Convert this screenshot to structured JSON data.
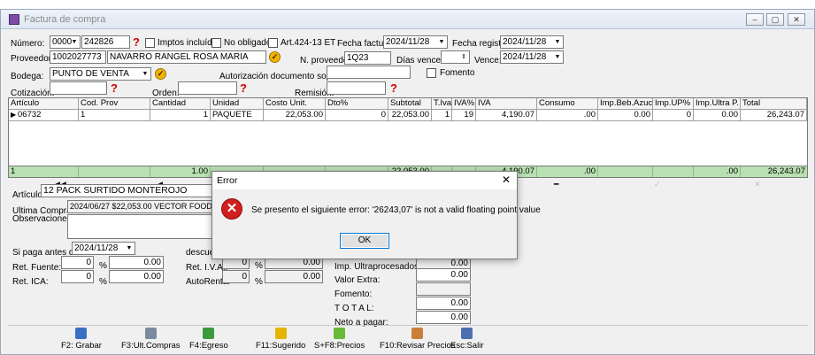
{
  "window": {
    "title": "Factura de compra"
  },
  "header": {
    "numero_label": "Número:",
    "numero_prefix": "0000",
    "numero_value": "242826",
    "imptos_incluidos": "Imptos incluídos",
    "no_obligado": "No obligado",
    "art_424": "Art.424-13 ET",
    "fecha_factura_label": "Fecha factura:",
    "fecha_factura": "2024/11/28",
    "fecha_registro_label": "Fecha registro:",
    "fecha_registro": "2024/11/28",
    "proveedor_label": "Proveedor:",
    "proveedor_id": "1002027773",
    "proveedor_nombre": "NAVARRO RANGEL ROSA MARIA",
    "n_proveedor_label": "N. proveedor:",
    "n_proveedor": "1Q23",
    "dias_vence_label": "Días vence:",
    "dias_vence": "",
    "vence_label": "Vence:",
    "vence": "2024/11/28",
    "bodega_label": "Bodega:",
    "bodega": "PUNTO DE VENTA",
    "autorizacion_label": "Autorización documento soporte:",
    "autorizacion": "",
    "fomento_label": "Fomento",
    "cotizacion_label": "Cotización:",
    "orden_label": "Orden:",
    "remision_label": "Remisión:"
  },
  "grid": {
    "columns": [
      "Artículo",
      "Cod. Prov",
      "Cantidad",
      "Unidad",
      "Costo Unit.",
      "Dto%",
      "Subtotal",
      "T.Iva",
      "IVA%",
      "IVA",
      "Consumo",
      "Imp.Beb.Azuc.",
      "Imp.UP%",
      "Imp.Ultra P.",
      "Total"
    ],
    "row": [
      "06732",
      "1",
      "1",
      "PAQUETE",
      "22,053.00",
      "0",
      "22,053.00",
      "1",
      "19",
      "4,190.07",
      ".00",
      "0.00",
      "0",
      "0.00",
      "26,243.07"
    ],
    "totals": {
      "first": "1",
      "cantidad": "1.00",
      "subtotal": "22,053.00",
      "iva": "4,190.07",
      "consumo": ".00",
      "imp_ultra": ".00",
      "total": "26,243.07"
    }
  },
  "detail": {
    "articulo_label": "Artículo:",
    "articulo": "12 PACK SURTIDO MONTEROJO",
    "ultima_compra_label": "Ultima Compra:",
    "ultima_compra": "2024/06/27 $22,053.00 VECTOR FOODS S.A.S",
    "observaciones_label": "Observaciones :",
    "si_paga_label": "Si paga antes de:",
    "si_paga": "2024/11/28",
    "descuento_label": "descuen",
    "ret_fuente_label": "Ret. Fuente:",
    "ret_fuente_pct": "0",
    "ret_fuente": "0.00",
    "ret_ica_label": "Ret. ICA:",
    "ret_ica_pct": "0",
    "ret_ica": "0.00",
    "ret_iva_label": "Ret. I.V.A.:",
    "ret_iva_pct": "0",
    "ret_iva": "0.00",
    "autorenta_label": "AutoRenta:",
    "autorenta_pct": "0",
    "autorenta": "0.00",
    "pct": "%"
  },
  "summary": {
    "imp_ultra_label": "Imp. Ultraprocesados:",
    "imp_ultra": "0.00",
    "valor_extra_label": "Valor Extra:",
    "valor_extra": "0.00",
    "fomento_label": "Fomento:",
    "total_label": "T O T A L:",
    "total": "0.00",
    "neto_label": "Neto a pagar:",
    "neto": "0.00"
  },
  "toolbar": [
    {
      "label": "F2: Grabar",
      "icon": "save-icon",
      "color": "#3a6fc4"
    },
    {
      "label": "F3:Ult.Compras",
      "icon": "search-icon",
      "color": "#7a8ba0"
    },
    {
      "label": "F4:Egreso",
      "icon": "cash-icon",
      "color": "#3c9a3c"
    },
    {
      "label": "F11:Sugerido",
      "icon": "lightning-icon",
      "color": "#e3b500"
    },
    {
      "label": "S+F8:Precios",
      "icon": "price-icon",
      "color": "#6aba3a"
    },
    {
      "label": "F10:Revisar Precios",
      "icon": "clipboard-icon",
      "color": "#c87f3a"
    },
    {
      "label": "Esc:Salir",
      "icon": "exit-icon",
      "color": "#4c6fb0"
    }
  ],
  "dialog": {
    "title": "Error",
    "message": "Se presento el siguiente error: '26243,07' is not a valid floating point value",
    "ok_label": "OK"
  }
}
